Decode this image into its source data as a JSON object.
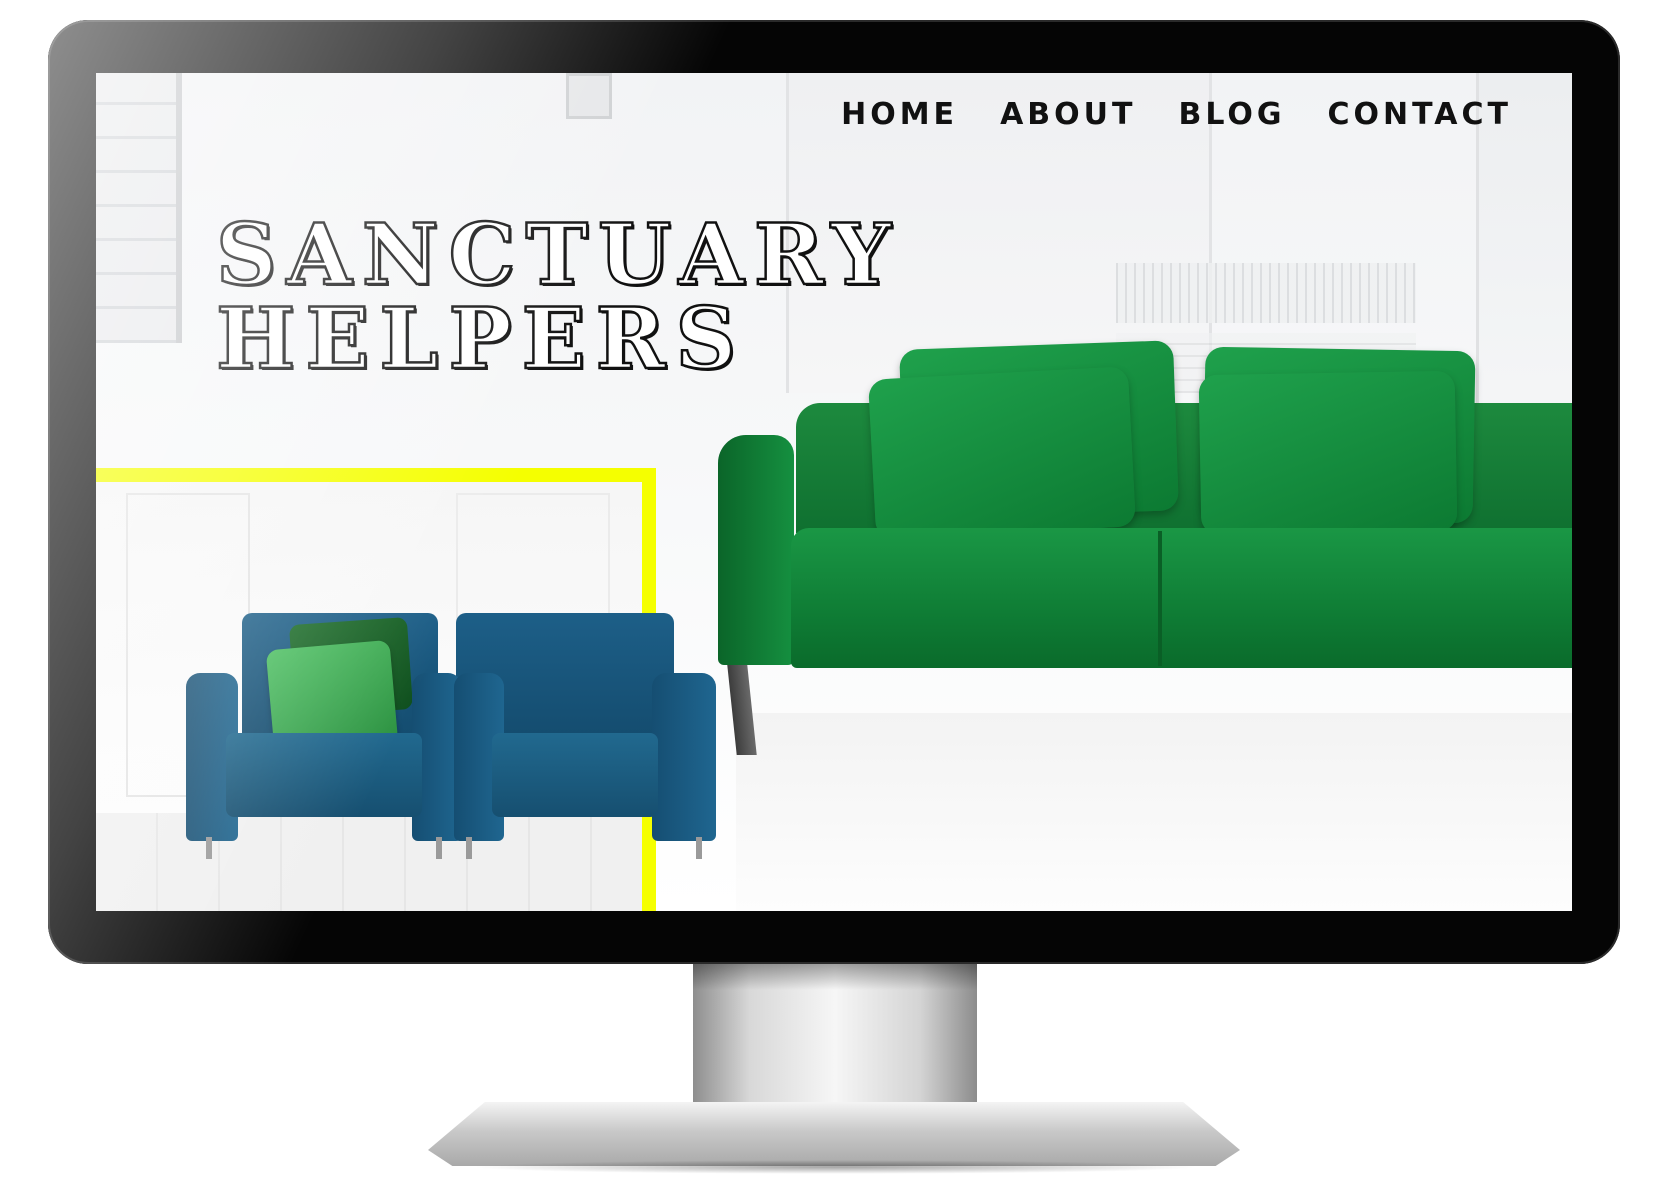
{
  "site": {
    "title_line1": "SANCTUARY",
    "title_line2": "HELPERS"
  },
  "nav": {
    "items": [
      {
        "label": "HOME"
      },
      {
        "label": "ABOUT"
      },
      {
        "label": "BLOG"
      },
      {
        "label": "CONTACT"
      }
    ]
  },
  "colors": {
    "accent_frame": "#f5ff00",
    "sofa_green": "#138a3c",
    "chair_blue": "#1b5a80",
    "text": "#111111"
  }
}
